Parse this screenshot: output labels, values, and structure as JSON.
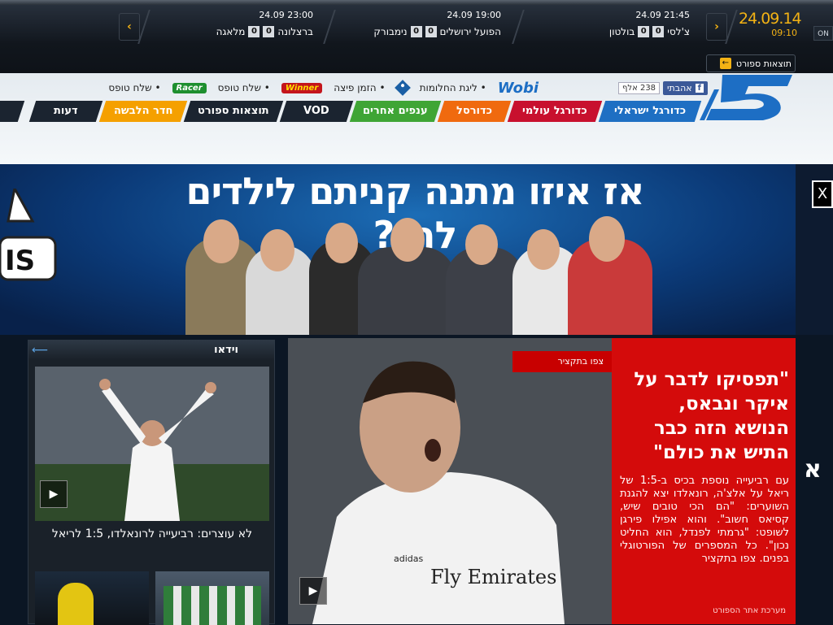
{
  "scores": {
    "date": "24.09.14",
    "time": "09:10",
    "on_label": "ON",
    "results_button": "תוצאות ספורט",
    "matches": [
      {
        "time": "24.09 23:00",
        "home": "ברצלונה",
        "home_score": "0",
        "away_score": "0",
        "away": "מלאגה"
      },
      {
        "time": "24.09 19:00",
        "home": "נימבורק",
        "home_score": "0",
        "away_score": "0",
        "away": "הפועל ירושלים"
      },
      {
        "time": "24.09 21:45",
        "home": "בולטון",
        "home_score": "0",
        "away_score": "0",
        "away": "צ'לסי"
      }
    ]
  },
  "header": {
    "facebook_like": "אהבתי",
    "facebook_count": "238 אלף",
    "links": [
      "ליגת החלומות",
      "הזמן פיצה",
      "שלח טופס",
      "שלח טופס"
    ],
    "brands": {
      "wobi": "Wobi",
      "winner": "Winner",
      "racer": "Racer"
    }
  },
  "nav": [
    {
      "label": "כדורגל ישראלי",
      "color": "#1e6fc3"
    },
    {
      "label": "כדורגל עולמי",
      "color": "#c8102e"
    },
    {
      "label": "כדורסל",
      "color": "#f06a0f"
    },
    {
      "label": "ענפים אחרים",
      "color": "#3fa535"
    },
    {
      "label": "VOD",
      "color": "#1b2430"
    },
    {
      "label": "תוצאות ספורט",
      "color": "#1b2430"
    },
    {
      "label": "חדר הלבשה",
      "color": "#f5a000"
    },
    {
      "label": "דעות",
      "color": "#1b2430"
    }
  ],
  "banner": {
    "title": "אז איזו מתנה קניתם לילדים לחג?"
  },
  "video": {
    "header": "וידאו",
    "caption": "לא עוצרים: רביעייה לרונאלדו, 1:5 לריאל"
  },
  "article": {
    "tag": "צפו בתקציר",
    "headline": "\"תפסיקו לדבר על איקר ונבאס, הנושא הזה כבר התיש את כולם\"",
    "body": "עם רביעייה נוספת בכיס ב-1:5 של ריאל על אלצ'ה, רונאלדו יצא להגנת השוערים: \"הם הכי טובים שיש, קסיאס חשוב\". והוא אפילו פירגן לשופט: \"גרמתי לפנדל, הוא החליט נכון\". כל המספרים של הפורטוגלי בפנים. צפו בתקציר",
    "byline": "מערכת אתר הספורט",
    "shirt_text": "Fly Emirates",
    "shirt_brand": "adidas"
  },
  "side": {
    "letter": "א"
  }
}
